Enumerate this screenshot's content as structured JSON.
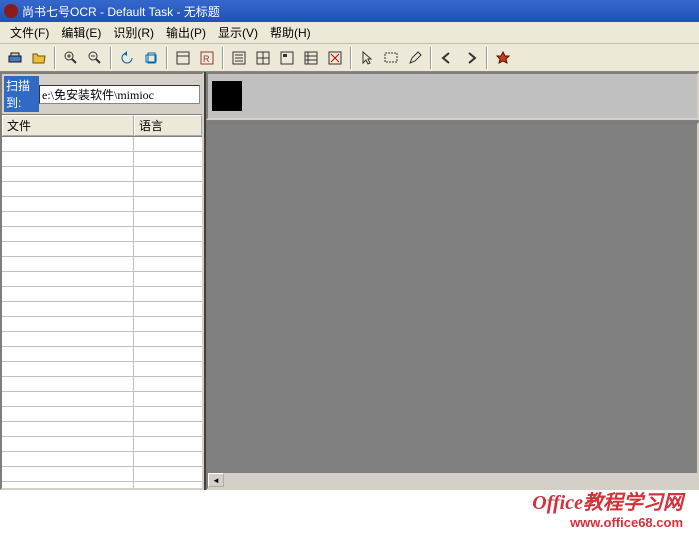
{
  "title": "尚书七号OCR - Default Task - 无标题",
  "menu": {
    "file": "文件(F)",
    "edit": "编辑(E)",
    "recognize": "识别(R)",
    "output": "输出(P)",
    "display": "显示(V)",
    "help": "帮助(H)"
  },
  "sidebar": {
    "scanLabel": "扫描到:",
    "scanPath": "e:\\免安装软件\\mimioc",
    "colFile": "文件",
    "colLang": "语言"
  },
  "logo": {
    "line1": "Office教程学习网",
    "line2": "www.office68.com"
  }
}
